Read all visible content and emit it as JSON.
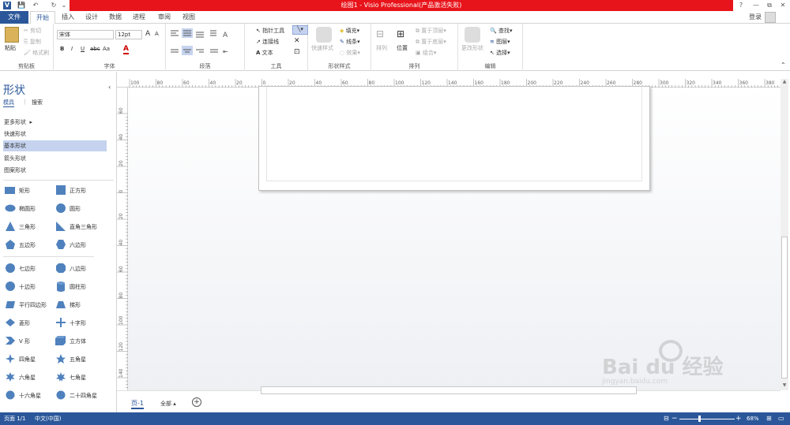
{
  "titlebar": {
    "title": "绘图1 - Visio Professional(产品激活失败)",
    "help": "?",
    "minimize": "—",
    "restore": "⧉",
    "close": "✕"
  },
  "tabs": {
    "file": "文件",
    "home": "开始",
    "insert": "插入",
    "design": "设计",
    "data": "数据",
    "process": "进程",
    "review": "审阅",
    "view": "视图",
    "login": "登录"
  },
  "ribbon": {
    "clipboard": {
      "paste": "粘贴",
      "cut": "剪切",
      "copy": "复制",
      "format_painter": "格式刷",
      "label": "剪贴板"
    },
    "font": {
      "name": "宋体",
      "size": "12pt",
      "grow": "A",
      "shrink": "A",
      "bold": "B",
      "italic": "I",
      "underline": "U",
      "strike": "abc",
      "case": "Aa",
      "color": "A",
      "label": "字体"
    },
    "paragraph": {
      "label": "段落"
    },
    "tools": {
      "pointer": "指针工具",
      "connector": "连接线",
      "text": "文本",
      "label": "工具"
    },
    "shape_styles": {
      "quick_styles": "快速样式",
      "fill": "填充",
      "line": "线条",
      "effects": "效果",
      "label": "形状样式"
    },
    "arrange": {
      "align": "排列",
      "position": "位置",
      "bring_front": "置于顶层",
      "send_back": "置于底层",
      "group": "组合",
      "label": "排列"
    },
    "editing": {
      "change_shape": "更改形状",
      "find": "查找",
      "layers": "图层",
      "select": "选择",
      "label": "编辑"
    }
  },
  "shapes_panel": {
    "title": "形状",
    "tab_stencils": "模具",
    "tab_search": "搜索",
    "stencils": [
      "更多形状",
      "快速形状",
      "基本形状",
      "箭头形状",
      "图案形状"
    ],
    "shapes": [
      [
        "矩形",
        "正方形"
      ],
      [
        "椭圆形",
        "圆形"
      ],
      [
        "三角形",
        "直角三角形"
      ],
      [
        "五边形",
        "六边形"
      ],
      [
        "七边形",
        "八边形"
      ],
      [
        "十边形",
        "圆柱形"
      ],
      [
        "平行四边形",
        "梯形"
      ],
      [
        "菱形",
        "十字形"
      ],
      [
        "V 形",
        "立方体"
      ],
      [
        "四角星",
        "五角星"
      ],
      [
        "六角星",
        "七角星"
      ],
      [
        "十六角星",
        "二十四角星"
      ]
    ]
  },
  "rulers": {
    "h_ticks": [
      "100",
      "80",
      "60",
      "40",
      "20",
      "0",
      "20",
      "40",
      "60",
      "80",
      "100",
      "120",
      "140",
      "160",
      "180",
      "200",
      "220",
      "240",
      "260",
      "280",
      "300",
      "320",
      "340",
      "360",
      "380"
    ],
    "v_ticks": [
      "60",
      "40",
      "20",
      "0",
      "20",
      "40",
      "60",
      "80",
      "100",
      "120",
      "140"
    ]
  },
  "page_tabs": {
    "page1": "页-1",
    "all": "全部"
  },
  "status": {
    "page": "页面 1/1",
    "language": "中文(中国)",
    "zoom": "68%"
  },
  "watermark": {
    "brand": "Bai du 经验",
    "url": "jingyan.baidu.com"
  },
  "colors": {
    "accent": "#2b579a",
    "titlebar_red": "#e8141b",
    "shape_blue": "#4f81bd",
    "selected_stencil": "#c5d3ef"
  }
}
